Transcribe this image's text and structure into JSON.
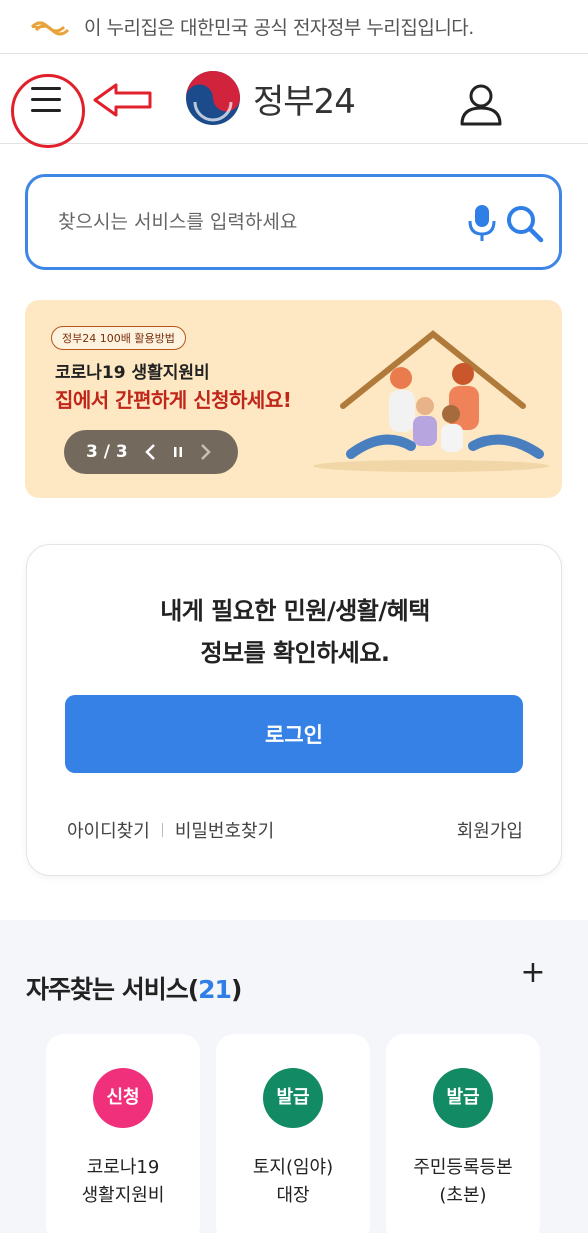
{
  "gov_banner": {
    "text": "이 누리집은 대한민국 공식 전자정부 누리집입니다."
  },
  "header": {
    "logo_text": "정부24"
  },
  "search": {
    "placeholder": "찾으시는 서비스를 입력하세요"
  },
  "banner": {
    "tag": "정부24 100배 활용방법",
    "line1": "코로나19 생활지원비",
    "line2": "집에서 간편하게 신청하세요!",
    "slide_counter": "3 / 3"
  },
  "login": {
    "message_line1": "내게 필요한 민원/생활/혜택",
    "message_line2": "정보를 확인하세요.",
    "button": "로그인",
    "find_id": "아이디찾기",
    "find_pw": "비밀번호찾기",
    "signup": "회원가입"
  },
  "frequent": {
    "title": "자주찾는 서비스(",
    "count": "21",
    "title_close": ")",
    "services": [
      {
        "badge": "신청",
        "badge_color": "#f0307a",
        "line1": "코로나19",
        "line2": "생활지원비"
      },
      {
        "badge": "발급",
        "badge_color": "#128a63",
        "line1": "토지(임야)",
        "line2": "대장"
      },
      {
        "badge": "발급",
        "badge_color": "#128a63",
        "line1": "주민등록등본",
        "line2": "(초본)"
      }
    ]
  },
  "colors": {
    "accent": "#3581e6",
    "annotation": "#e0202a",
    "banner_bg": "#fde8c3"
  }
}
